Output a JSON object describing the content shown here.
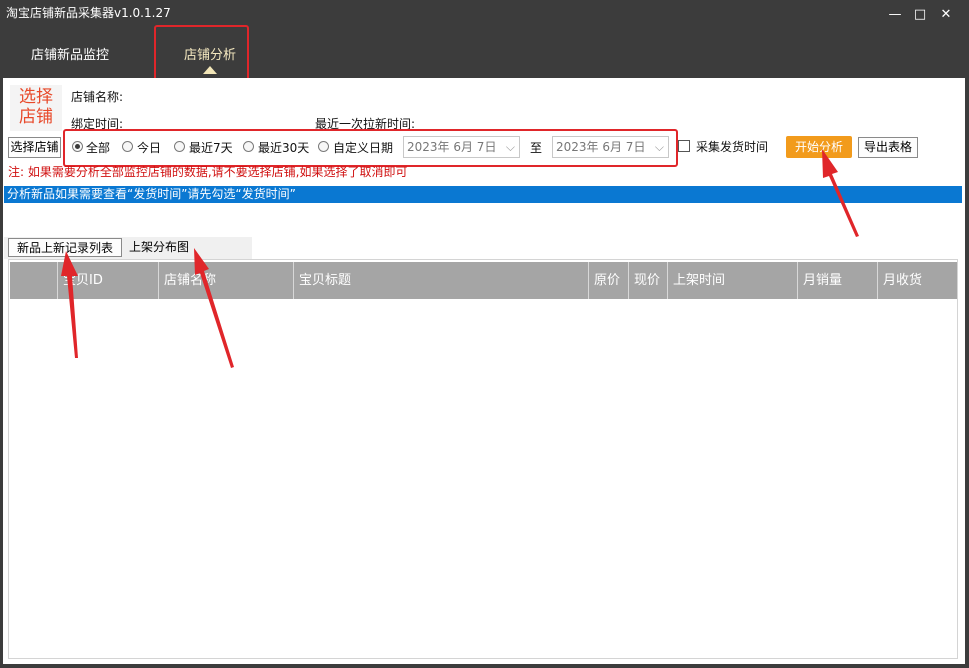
{
  "app": {
    "title": "淘宝店铺新品采集器v1.0.1.27"
  },
  "window_controls": {
    "minimize": "—",
    "maximize": "□",
    "close": "✕"
  },
  "nav": {
    "tabs": [
      {
        "label": "店铺新品监控"
      },
      {
        "label": "店铺分析"
      }
    ]
  },
  "shop": {
    "logo_text_line1": "选择",
    "logo_text_line2": "店铺",
    "name_label": "店铺名称:",
    "bind_time_label": "绑定时间:",
    "last_pull_label": "最近一次拉新时间:",
    "select_button": "选择店铺"
  },
  "filter": {
    "radios": [
      {
        "label": "全部",
        "selected": true
      },
      {
        "label": "今日",
        "selected": false
      },
      {
        "label": "最近7天",
        "selected": false
      },
      {
        "label": "最近30天",
        "selected": false
      },
      {
        "label": "自定义日期",
        "selected": false
      }
    ],
    "date_from": "2023年  6月  7日",
    "to_label": "至",
    "date_to": "2023年  6月  7日",
    "collect_ship_time_label": "采集发货时间",
    "collect_ship_time_checked": false,
    "start_button": "开始分析",
    "export_button": "导出表格"
  },
  "note": "注: 如果需要分析全部监控店铺的数据,请不要选择店铺,如果选择了取消即可",
  "info_bar": "分析新品如果需要查看“发货时间”请先勾选“发货时间”",
  "subtabs": [
    {
      "label": "新品上新记录列表"
    },
    {
      "label": "上架分布图"
    }
  ],
  "table": {
    "columns": [
      "",
      "宝贝ID",
      "店铺名称",
      "宝贝标题",
      "原价",
      "现价",
      "上架时间",
      "月销量",
      "月收货"
    ],
    "rows": []
  },
  "colors": {
    "accent": "#f29b1c",
    "info_bar": "#0a78d2",
    "annotation": "#e0262a",
    "titlebar": "#3c3c3c"
  }
}
